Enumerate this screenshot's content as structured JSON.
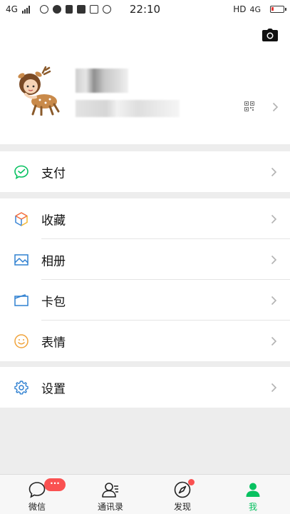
{
  "status_bar": {
    "network_left": "4G",
    "time": "22:10",
    "hd": "HD",
    "network_right": "4G"
  },
  "profile": {
    "camera_icon": "camera-icon",
    "qr_icon": "qr-code-icon"
  },
  "menu": {
    "pay": {
      "label": "支付",
      "icon": "pay-icon",
      "color": "#07c160"
    },
    "favorites": {
      "label": "收藏",
      "icon": "cube-icon"
    },
    "album": {
      "label": "相册",
      "icon": "image-icon",
      "color": "#2f80d1"
    },
    "cards": {
      "label": "卡包",
      "icon": "wallet-icon",
      "color": "#2f80d1"
    },
    "stickers": {
      "label": "表情",
      "icon": "smiley-icon",
      "color": "#f0a33b"
    },
    "settings": {
      "label": "设置",
      "icon": "gear-icon",
      "color": "#2f80d1"
    }
  },
  "tabbar": {
    "chats": {
      "label": "微信",
      "badge": "···"
    },
    "contacts": {
      "label": "通讯录"
    },
    "discover": {
      "label": "发现"
    },
    "me": {
      "label": "我",
      "active_color": "#07c160"
    }
  }
}
